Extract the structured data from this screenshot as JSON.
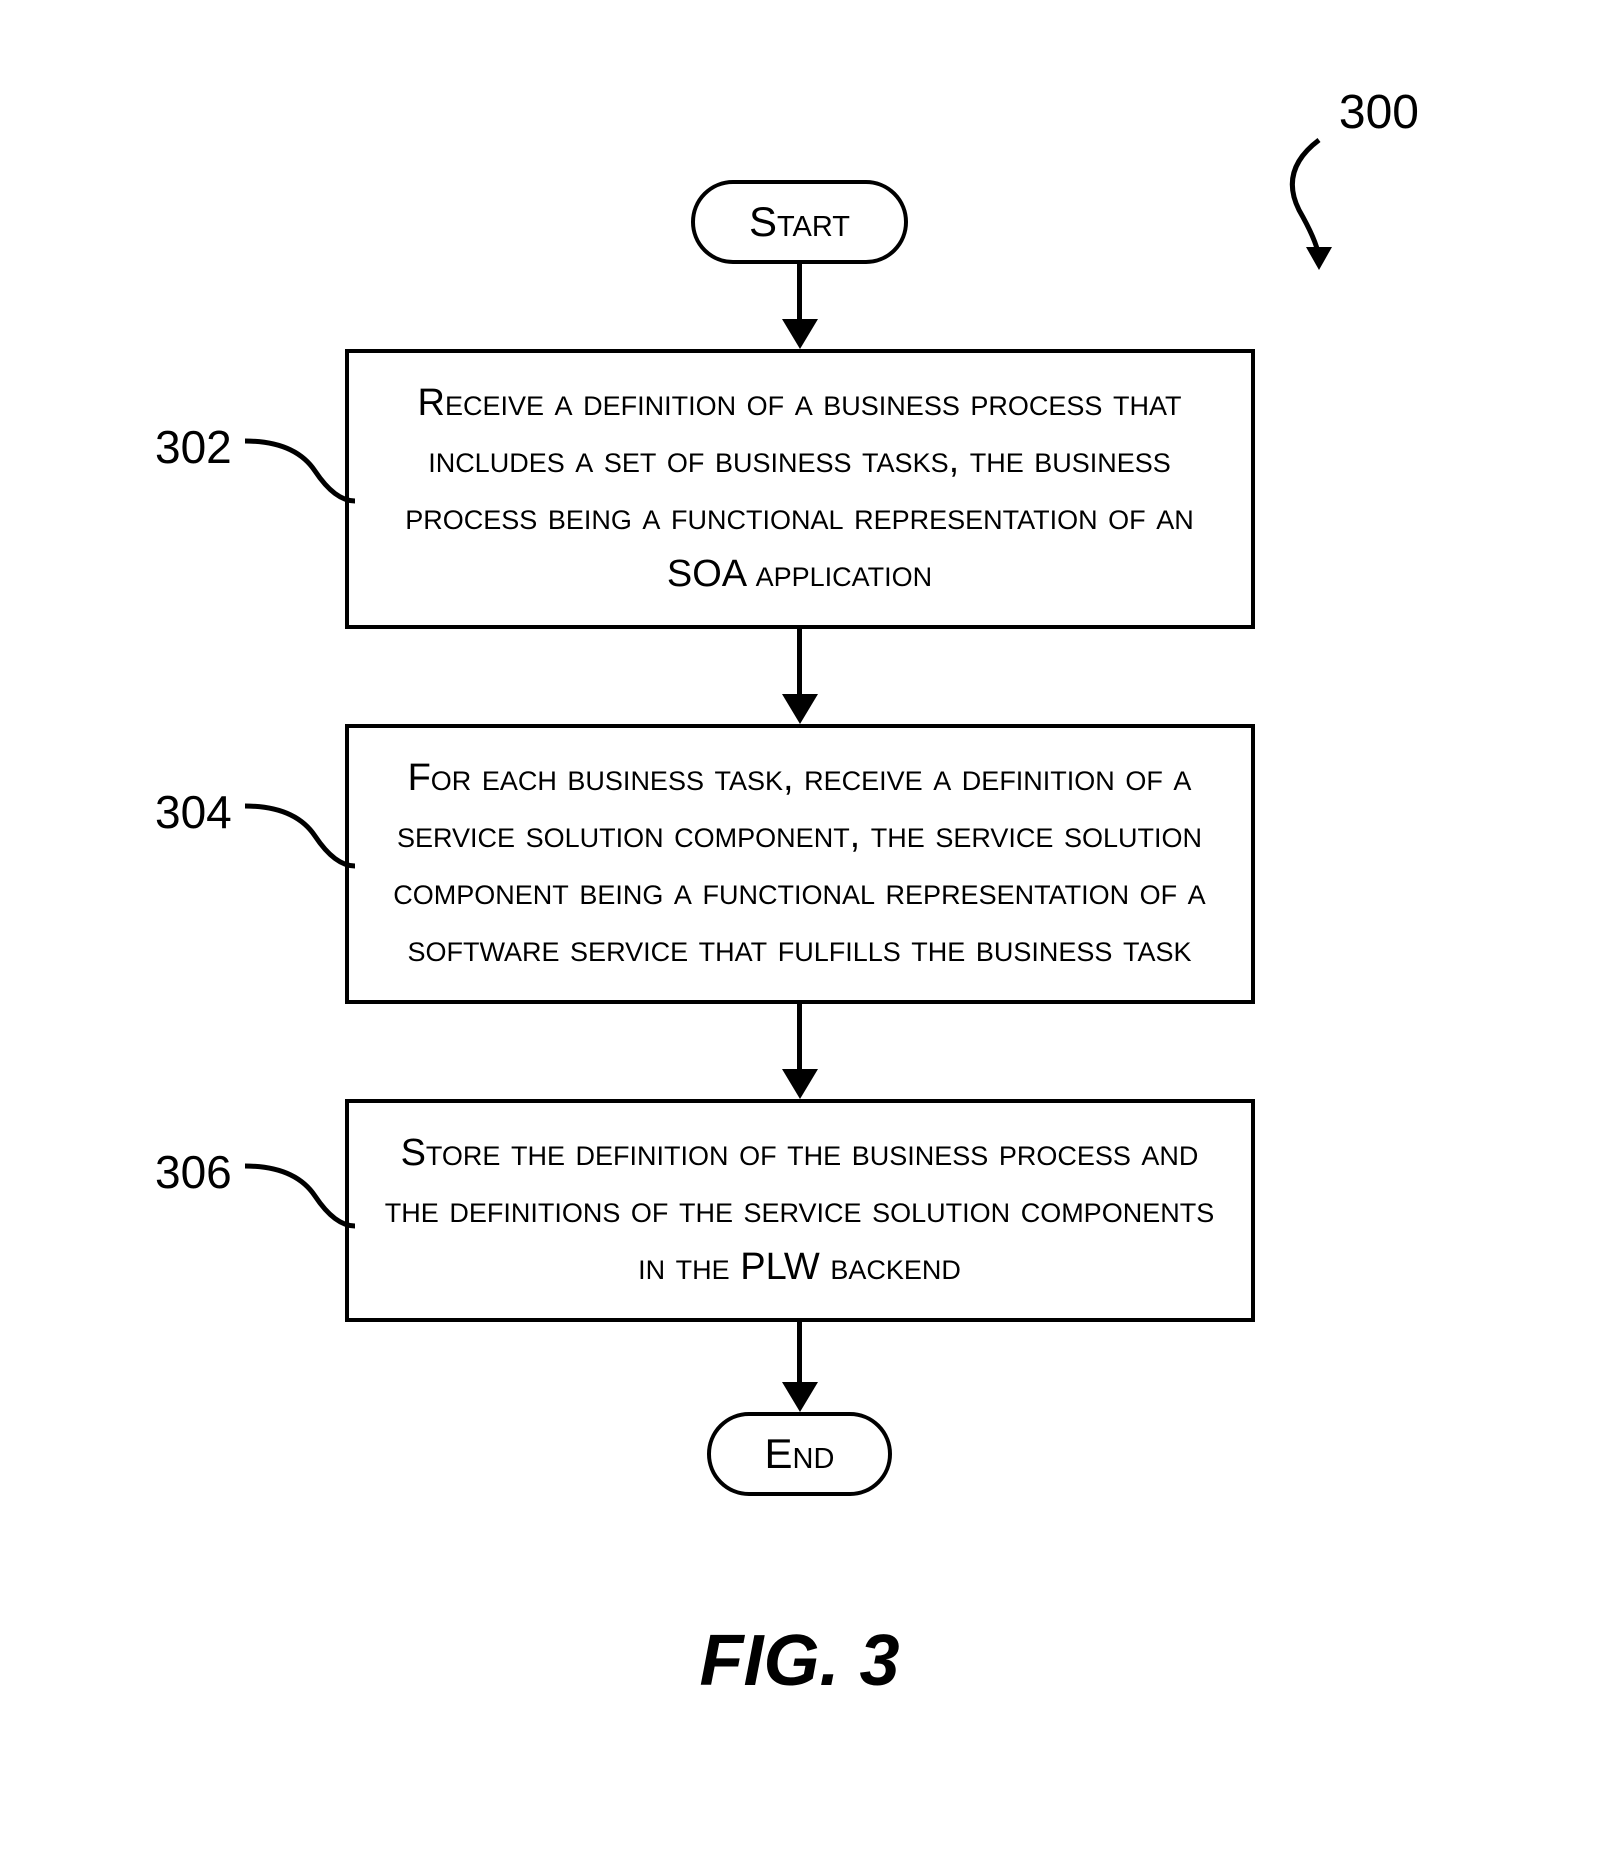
{
  "figure": {
    "ref_number": "300",
    "caption": "FIG. 3",
    "start_label": "Start",
    "end_label": "End",
    "steps": [
      {
        "ref": "302",
        "text": "Receive a definition of a business process that includes a set of business tasks, the business process being a functional representation of an SOA application"
      },
      {
        "ref": "304",
        "text": "For each business task, receive a definition of a service solution component, the service solution component being a functional representation of a software service that fulfills the business task"
      },
      {
        "ref": "306",
        "text": "Store the definition of the business process and the definitions of the service solution components in the PLW backend"
      }
    ]
  }
}
